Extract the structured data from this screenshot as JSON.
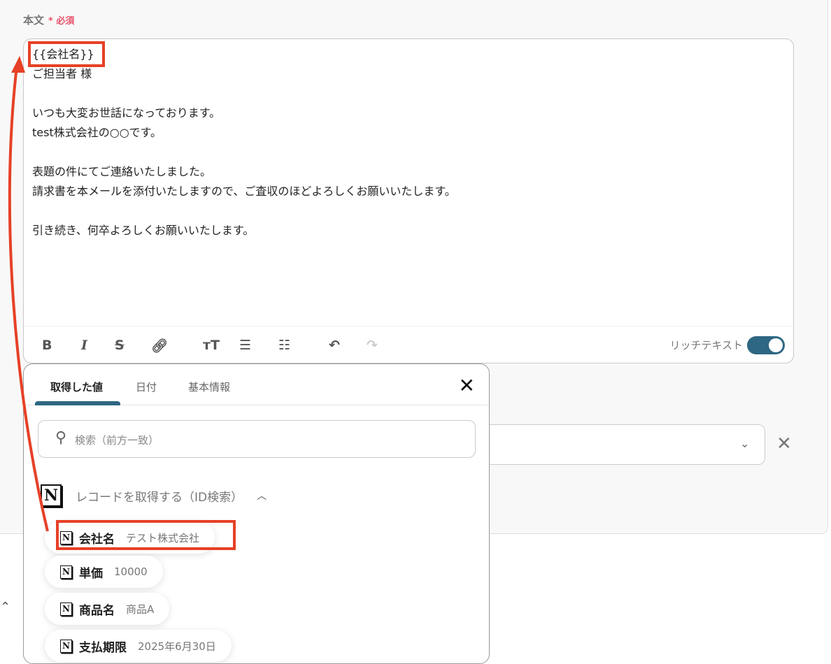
{
  "field": {
    "label": "本文",
    "required_mark": "*",
    "required_text": "必須"
  },
  "editor": {
    "body": "{{会社名}}\nご担当者 様\n\nいつも大変お世話になっております。\ntest株式会社の○○です。\n\n表題の件にてご連絡いたしました。\n請求書を本メールを添付いたしますので、ご査収のほどよろしくお願いいたします。\n\n引き続き、何卒よろしくお願いいたします。",
    "rich_text_label": "リッチテキスト",
    "rich_text_on": true
  },
  "popup": {
    "tabs": [
      {
        "label": "取得した値"
      },
      {
        "label": "日付"
      },
      {
        "label": "基本情報"
      }
    ],
    "search_placeholder": "検索（前方一致）",
    "group_title": "レコードを取得する（ID検索）",
    "items": [
      {
        "name": "会社名",
        "value": "テスト株式会社"
      },
      {
        "name": "単価",
        "value": "10000"
      },
      {
        "name": "商品名",
        "value": "商品A"
      },
      {
        "name": "支払期限",
        "value": "2025年6月30日"
      }
    ]
  },
  "colors": {
    "accent": "#2e6783",
    "highlight": "#e64127",
    "required": "#e8536b"
  }
}
